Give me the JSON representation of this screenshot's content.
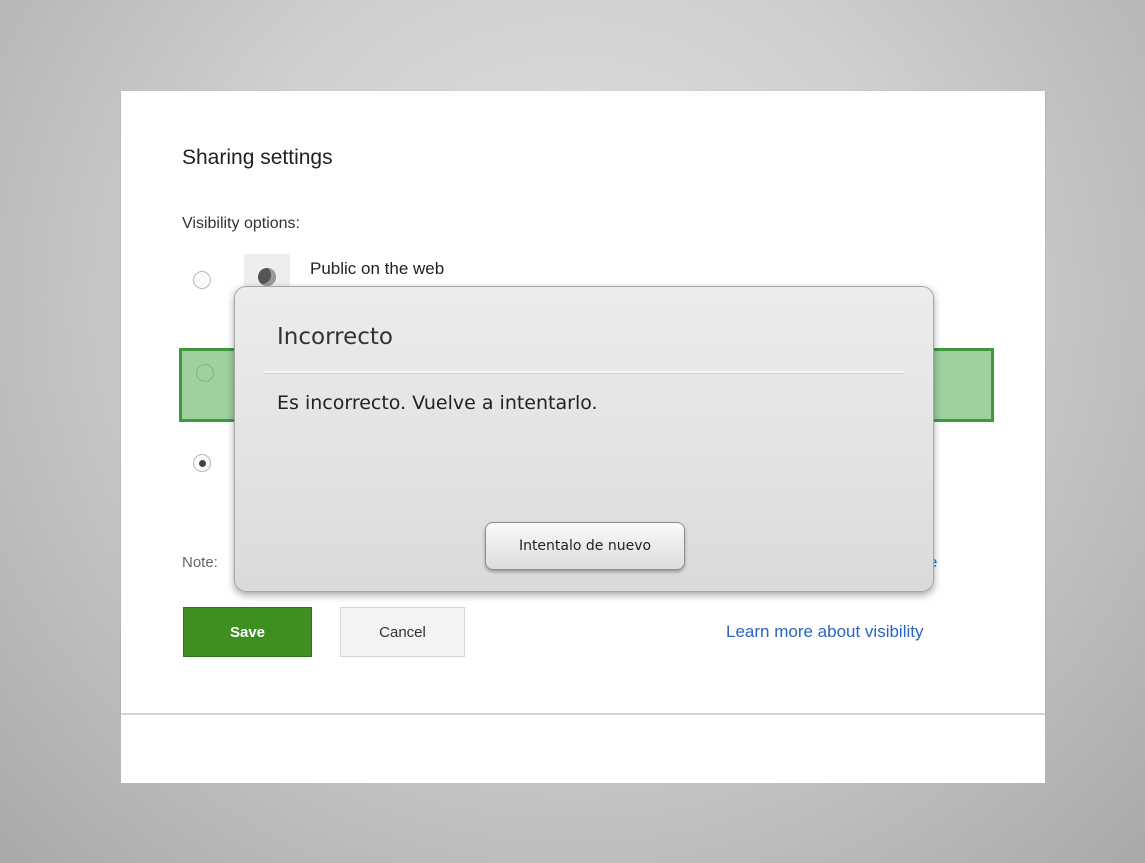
{
  "sharing": {
    "title": "Sharing settings",
    "visibility_label": "Visibility options:",
    "options": [
      {
        "label": "Public on the web",
        "icon": "globe-icon",
        "selected": false
      },
      {
        "label": "",
        "selected": false
      },
      {
        "label": "",
        "selected": true
      }
    ],
    "note_prefix": "Note:",
    "note_tail": "e",
    "save_label": "Save",
    "cancel_label": "Cancel",
    "learn_more": "Learn more about visibility"
  },
  "dialog": {
    "title": "Incorrecto",
    "message": "Es incorrecto. Vuelve a intentarlo.",
    "retry_label": "Intentalo de nuevo"
  },
  "colors": {
    "save_green": "#3e8f1f",
    "highlight_green": "#9fd09f",
    "highlight_border": "#3f9a3f",
    "link_blue": "#2a64c5"
  }
}
